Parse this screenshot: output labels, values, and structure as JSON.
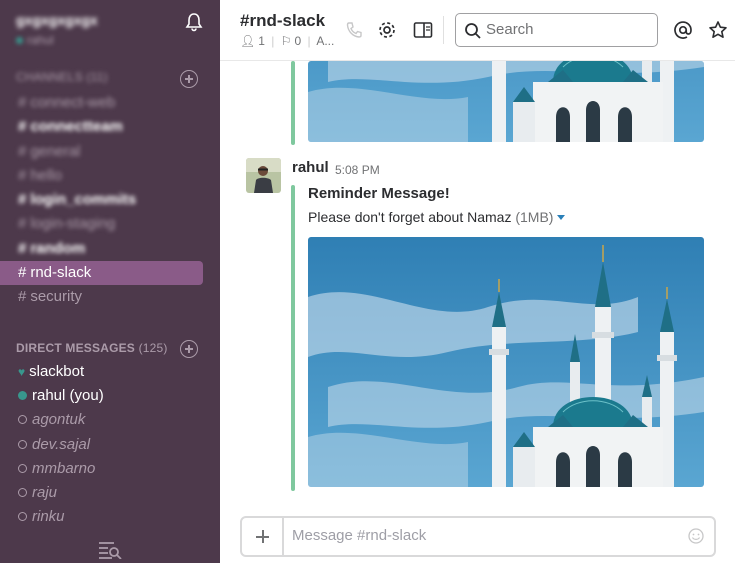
{
  "team": {
    "name": "gxgxgxgxgx",
    "user_status": "rahul"
  },
  "sidebar": {
    "channels_heading": "CHANNELS (11)",
    "channels": [
      {
        "label": "connect-web",
        "style": "blur"
      },
      {
        "label": "connectteam",
        "style": "blur bold"
      },
      {
        "label": "general",
        "style": "blur"
      },
      {
        "label": "hello",
        "style": "blur"
      },
      {
        "label": "login_commits",
        "style": "blur bold"
      },
      {
        "label": "login-staging",
        "style": "blur"
      },
      {
        "label": "random",
        "style": "blur bold"
      },
      {
        "label": "rnd-slack",
        "style": "active"
      },
      {
        "label": "security",
        "style": ""
      }
    ],
    "dm_heading": "DIRECT MESSAGES",
    "dm_count": "(125)",
    "dms": [
      {
        "label": "slackbot",
        "presence": "heart",
        "style": ""
      },
      {
        "label": "rahul (you)",
        "presence": "online",
        "style": ""
      },
      {
        "label": "agontuk",
        "presence": "offline",
        "style": "away"
      },
      {
        "label": "dev.sajal",
        "presence": "offline",
        "style": "away"
      },
      {
        "label": "mmbarno",
        "presence": "offline",
        "style": "away"
      },
      {
        "label": "raju",
        "presence": "offline",
        "style": "away"
      },
      {
        "label": "rinku",
        "presence": "offline",
        "style": "away"
      }
    ]
  },
  "header": {
    "channel_title": "#rnd-slack",
    "members": "1",
    "pinned": "0",
    "topic": "A...",
    "search_placeholder": "Search"
  },
  "message": {
    "sender": "rahul",
    "time": "5:08 PM",
    "title": "Reminder Message!",
    "text": "Please don't forget about Namaz",
    "size": "(1MB)"
  },
  "composer": {
    "placeholder": "Message #rnd-slack"
  },
  "colors": {
    "sidebar": "#4d394b",
    "active": "#8a5b88",
    "accent_bar": "#7fc89e",
    "presence": "#38978d"
  }
}
